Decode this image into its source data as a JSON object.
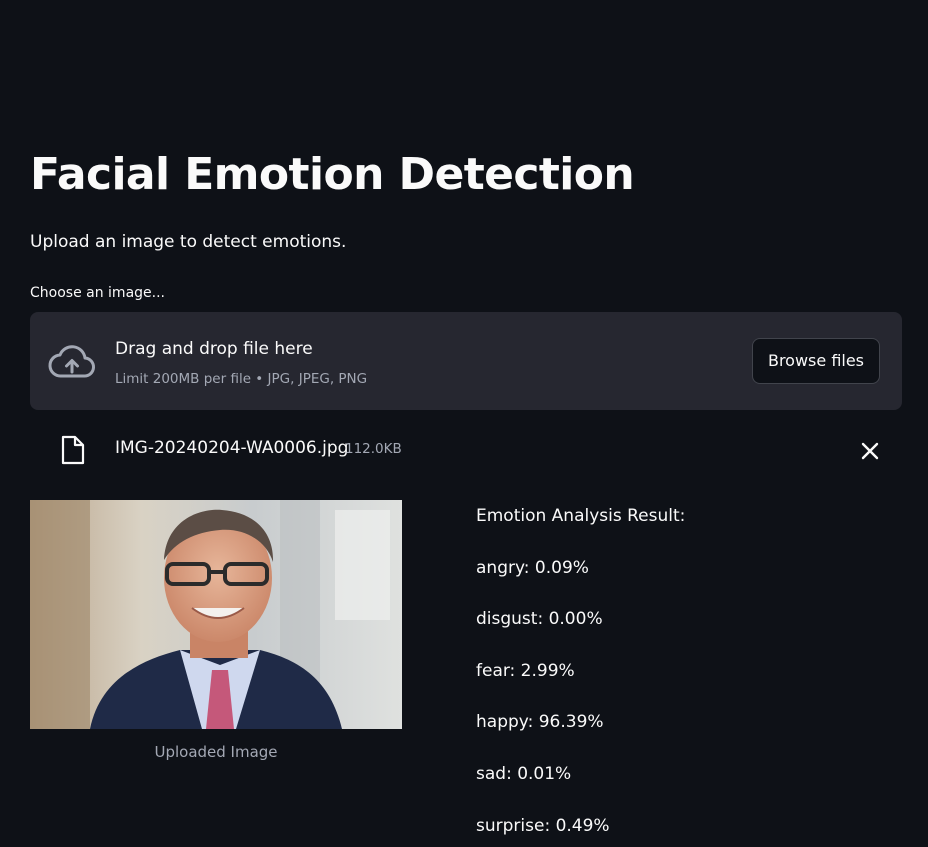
{
  "page": {
    "title": "Facial Emotion Detection",
    "subtitle": "Upload an image to detect emotions."
  },
  "uploader": {
    "label": "Choose an image...",
    "drop_text": "Drag and drop file here",
    "limit_text": "Limit 200MB per file • JPG, JPEG, PNG",
    "browse_label": "Browse files",
    "icon": "cloud-upload-icon"
  },
  "uploaded_file": {
    "name": "IMG-20240204-WA0006.jpg",
    "size": "112.0KB",
    "file_icon": "file-icon",
    "remove_icon": "close-icon"
  },
  "image": {
    "caption": "Uploaded Image"
  },
  "results": {
    "heading": "Emotion Analysis Result:",
    "items": [
      "angry: 0.09%",
      "disgust: 0.00%",
      "fear: 2.99%",
      "happy: 96.39%",
      "sad: 0.01%",
      "surprise: 0.49%"
    ]
  },
  "colors": {
    "background": "#0e1117",
    "dropzone": "#262730",
    "text": "#fafafa",
    "muted_text": "#a3a8b4"
  }
}
